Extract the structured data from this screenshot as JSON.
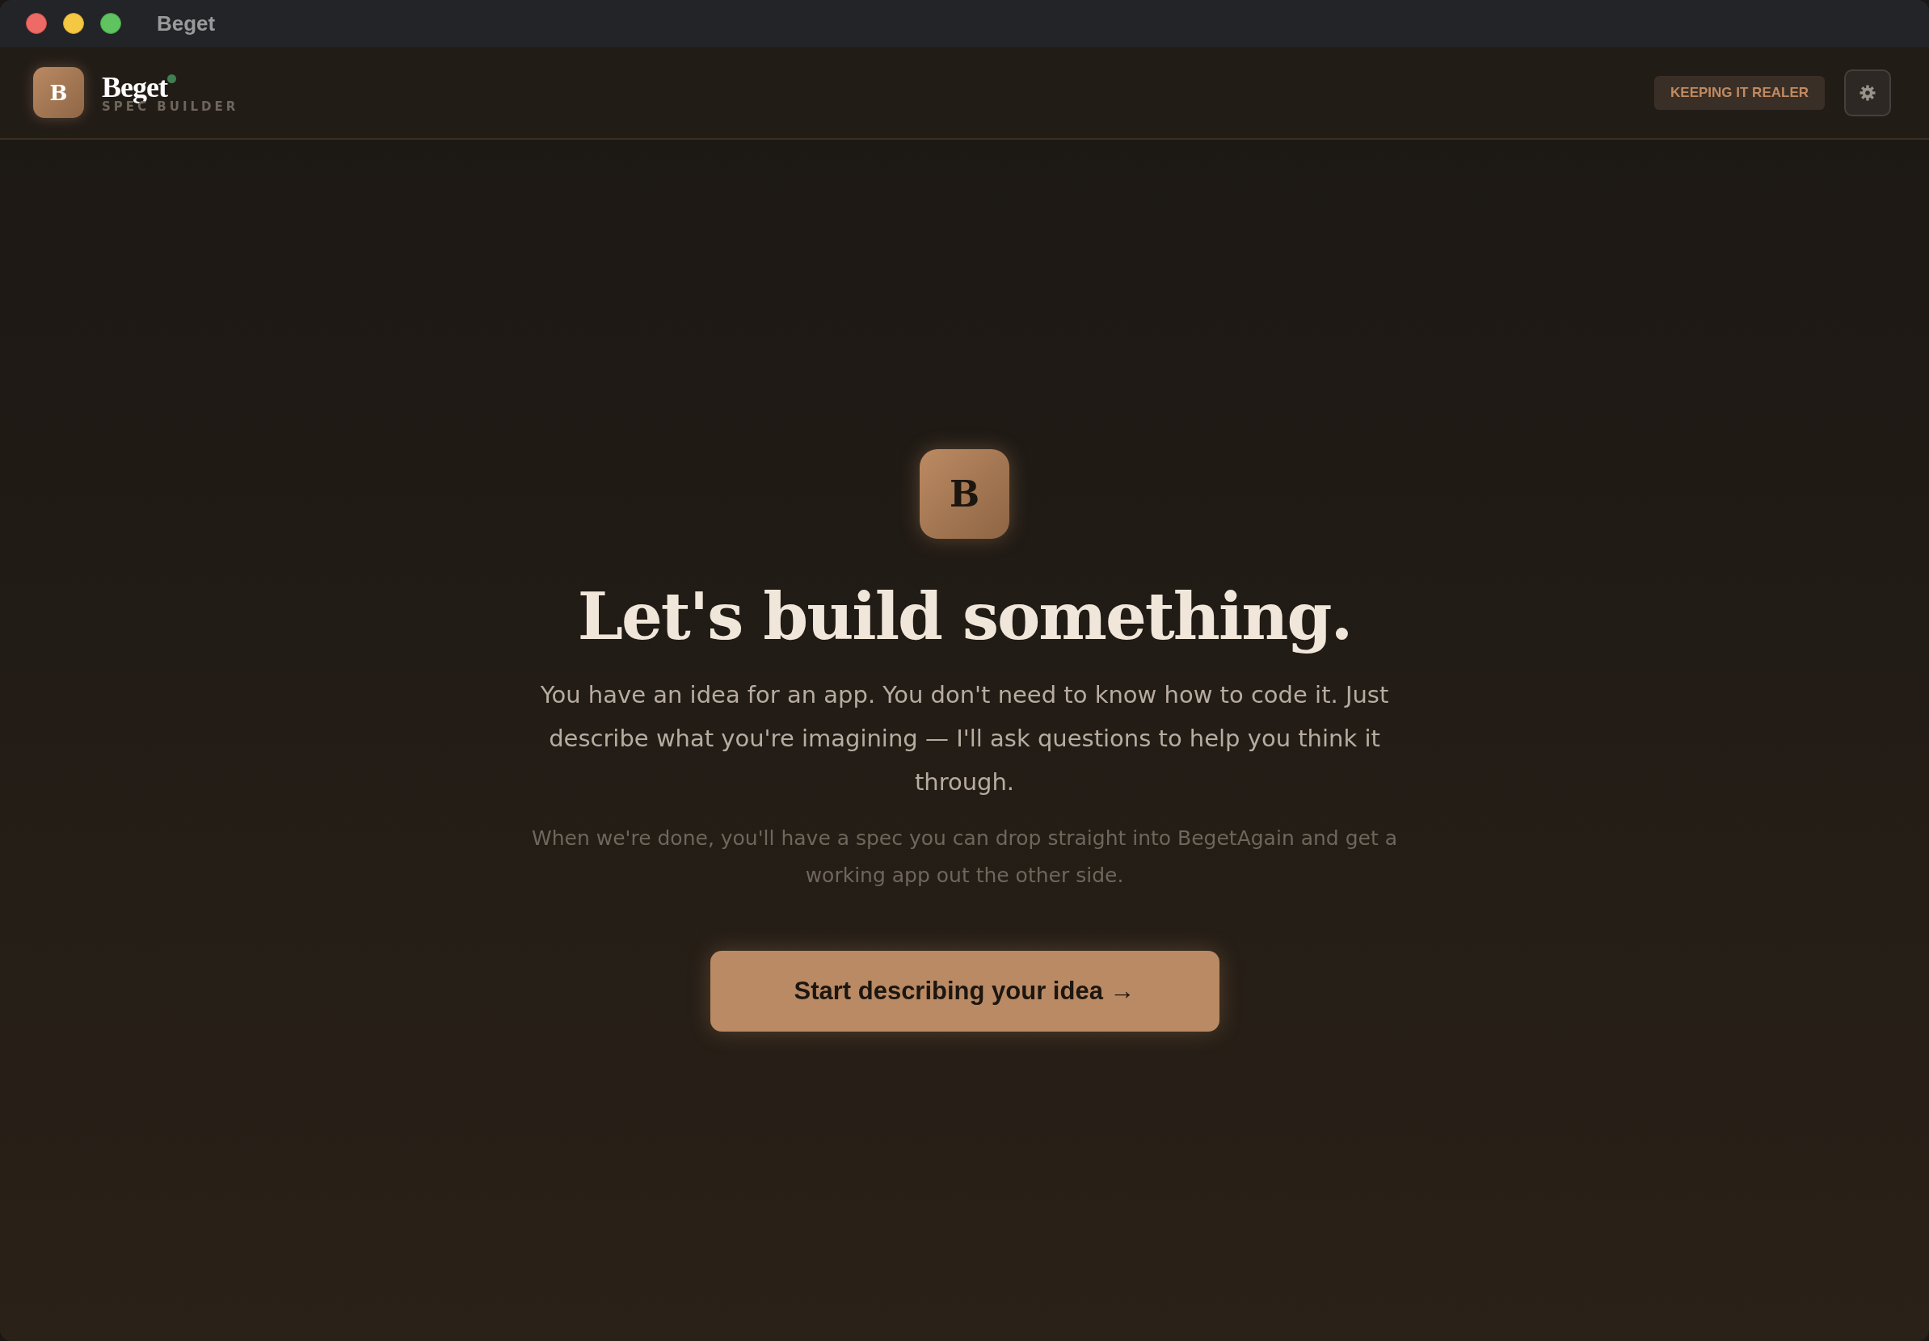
{
  "window": {
    "title": "Beget"
  },
  "app": {
    "logo_letter": "B",
    "name": "Beget",
    "subtitle": "SPEC BUILDER"
  },
  "header": {
    "badge": "KEEPING IT REALER"
  },
  "hero": {
    "logo_letter": "B",
    "heading": "Let's build something.",
    "intro": "You have an idea for an app. You don't need to know how to code it. Just describe what you're imagining — I'll ask questions to help you think it through.",
    "note": "When we're done, you'll have a spec you can drop straight into BegetAgain and get a working app out the other side.",
    "cta": "Start describing your idea →"
  }
}
